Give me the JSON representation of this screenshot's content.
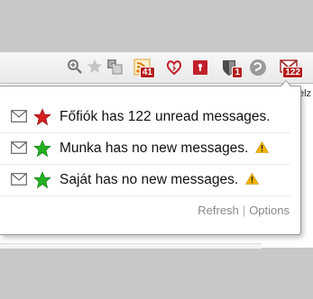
{
  "toolbar": {
    "icons": {
      "zoom": "zoom-icon",
      "bookmark_star": "bookmark-star-icon",
      "translate": "translate-icon",
      "rss": "rss-icon",
      "heartbleed": "heart-icon",
      "lastpass": "lock-icon",
      "shield": "shield-icon",
      "spiral": "spiral-icon",
      "gmail": "mail-icon"
    },
    "rss_badge": "41",
    "shield_badge": "1",
    "gmail_badge": "122"
  },
  "edge_text": "elz",
  "accounts": [
    {
      "text": "Főfiók has 122 unread messages.",
      "star_color": "#d42020",
      "warning": false
    },
    {
      "text": "Munka has no new messages.",
      "star_color": "#22b022",
      "warning": true
    },
    {
      "text": "Saját has no new messages.",
      "star_color": "#22b022",
      "warning": true
    }
  ],
  "footer": {
    "refresh": "Refresh",
    "separator": "|",
    "options": "Options"
  },
  "colors": {
    "red_star": "#d42020",
    "green_star": "#22b022",
    "warning": "#f2b300",
    "badge": "#b41d1d"
  }
}
